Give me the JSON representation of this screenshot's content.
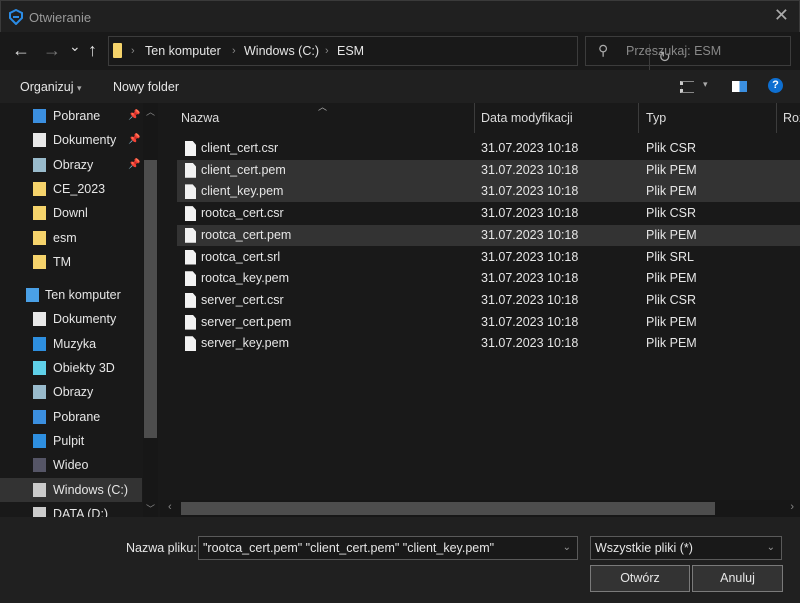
{
  "window": {
    "title": "Otwieranie",
    "close_icon": "close-icon"
  },
  "nav": {
    "back": "←",
    "forward": "→",
    "recent": "⌄",
    "up": "↑",
    "breadcrumb": [
      "Ten komputer",
      "Windows (C:)",
      "ESM"
    ],
    "refresh": "↻",
    "search_placeholder": "Przeszukaj: ESM"
  },
  "toolbar": {
    "organize": "Organizuj",
    "organize_arrow": "▾",
    "new_folder": "Nowy folder",
    "help": "?"
  },
  "sidebar": {
    "items": [
      {
        "label": "Pobrane",
        "icon": "download-icon",
        "pinned": true
      },
      {
        "label": "Dokumenty",
        "icon": "documents-icon",
        "pinned": true
      },
      {
        "label": "Obrazy",
        "icon": "pictures-icon",
        "pinned": true
      },
      {
        "label": "CE_2023",
        "icon": "folder-icon"
      },
      {
        "label": "Downl",
        "icon": "folder-icon"
      },
      {
        "label": "esm",
        "icon": "folder-icon"
      },
      {
        "label": "TM",
        "icon": "folder-icon"
      },
      {
        "label": "Ten komputer",
        "icon": "computer-icon"
      },
      {
        "label": "Dokumenty",
        "icon": "documents-icon"
      },
      {
        "label": "Muzyka",
        "icon": "music-icon"
      },
      {
        "label": "Obiekty 3D",
        "icon": "3d-objects-icon"
      },
      {
        "label": "Obrazy",
        "icon": "pictures-icon"
      },
      {
        "label": "Pobrane",
        "icon": "download-icon"
      },
      {
        "label": "Pulpit",
        "icon": "desktop-icon"
      },
      {
        "label": "Wideo",
        "icon": "video-icon"
      },
      {
        "label": "Windows (C:)",
        "icon": "drive-icon",
        "selected": true
      },
      {
        "label": "DATA (D:)",
        "icon": "drive-icon"
      }
    ]
  },
  "columns": [
    "Nazwa",
    "Data modyfikacji",
    "Typ",
    "Roz"
  ],
  "files": [
    {
      "name": "client_cert.csr",
      "date": "31.07.2023 10:18",
      "type": "Plik CSR",
      "selected": false
    },
    {
      "name": "client_cert.pem",
      "date": "31.07.2023 10:18",
      "type": "Plik PEM",
      "selected": true
    },
    {
      "name": "client_key.pem",
      "date": "31.07.2023 10:18",
      "type": "Plik PEM",
      "selected": true
    },
    {
      "name": "rootca_cert.csr",
      "date": "31.07.2023 10:18",
      "type": "Plik CSR",
      "selected": false
    },
    {
      "name": "rootca_cert.pem",
      "date": "31.07.2023 10:18",
      "type": "Plik PEM",
      "selected": true
    },
    {
      "name": "rootca_cert.srl",
      "date": "31.07.2023 10:18",
      "type": "Plik SRL",
      "selected": false
    },
    {
      "name": "rootca_key.pem",
      "date": "31.07.2023 10:18",
      "type": "Plik PEM",
      "selected": false
    },
    {
      "name": "server_cert.csr",
      "date": "31.07.2023 10:18",
      "type": "Plik CSR",
      "selected": false
    },
    {
      "name": "server_cert.pem",
      "date": "31.07.2023 10:18",
      "type": "Plik PEM",
      "selected": false
    },
    {
      "name": "server_key.pem",
      "date": "31.07.2023 10:18",
      "type": "Plik PEM",
      "selected": false
    }
  ],
  "footer": {
    "filename_label": "Nazwa pliku:",
    "filename_value": "\"rootca_cert.pem\" \"client_cert.pem\" \"client_key.pem\"",
    "filter": "Wszystkie pliki (*)",
    "open": "Otwórz",
    "cancel": "Anuluj"
  },
  "colors": {
    "accent": "#0078d7",
    "selection": "#333333",
    "folder": "#f5d36b"
  }
}
